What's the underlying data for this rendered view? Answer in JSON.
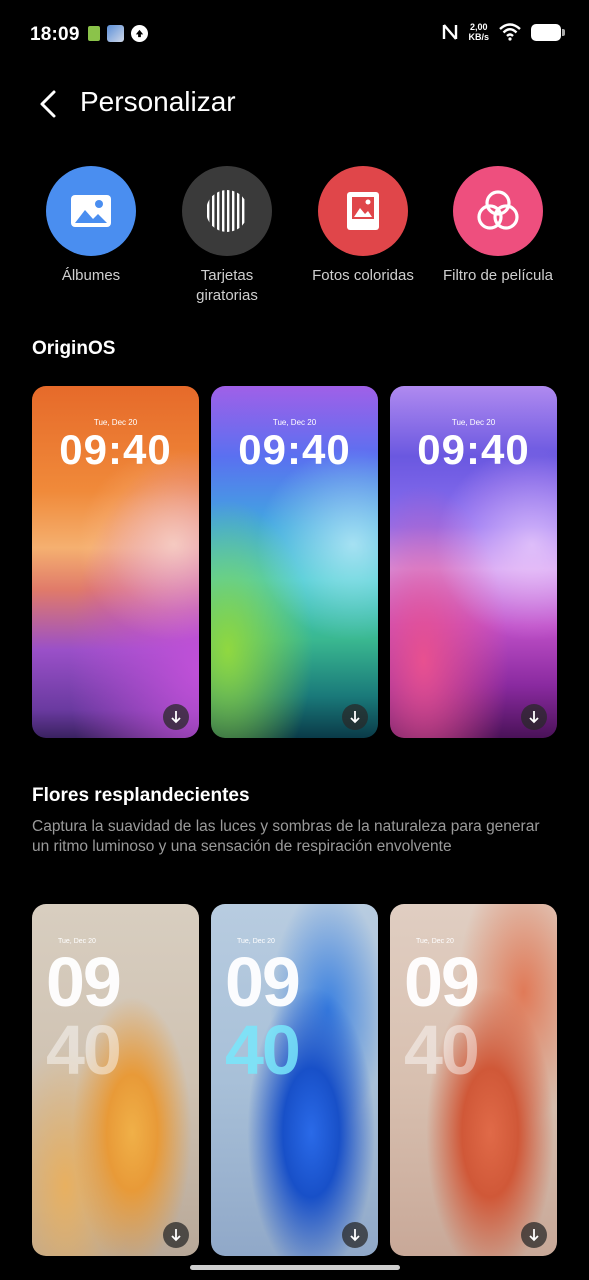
{
  "status_bar": {
    "time": "18:09",
    "net_speed_value": "2,00",
    "net_speed_unit": "KB/s",
    "icons": [
      "notification-icon",
      "app-icon",
      "upload-icon",
      "nfc-icon",
      "wifi-icon",
      "battery-icon"
    ]
  },
  "header": {
    "title": "Personalizar",
    "back_icon": "chevron-left-icon"
  },
  "shortcuts": [
    {
      "label": "Álbumes",
      "icon": "image-icon",
      "color": "#4a8ef0"
    },
    {
      "label": "Tarjetas giratorias",
      "icon": "striped-circle-icon",
      "color": "#3a3a3a"
    },
    {
      "label": "Fotos coloridas",
      "icon": "photo-frame-icon",
      "color": "#e0464a"
    },
    {
      "label": "Filtro de película",
      "icon": "three-circles-icon",
      "color": "#ee4f7e"
    }
  ],
  "sections": {
    "originos": {
      "title": "OriginOS",
      "wallpapers": [
        {
          "date": "Tue, Dec 20",
          "time": "09:40"
        },
        {
          "date": "Tue, Dec 20",
          "time": "09:40"
        },
        {
          "date": "Tue, Dec 20",
          "time": "09:40"
        }
      ]
    },
    "flores": {
      "title": "Flores resplandecientes",
      "description": "Captura la suavidad de las luces y sombras de la naturaleza para generar un ritmo luminoso y una sensación de respiración envolvente",
      "wallpapers": [
        {
          "date": "Tue, Dec 20",
          "hour": "09",
          "minute": "40"
        },
        {
          "date": "Tue, Dec 20",
          "hour": "09",
          "minute": "40"
        },
        {
          "date": "Tue, Dec 20",
          "hour": "09",
          "minute": "40"
        }
      ]
    }
  }
}
